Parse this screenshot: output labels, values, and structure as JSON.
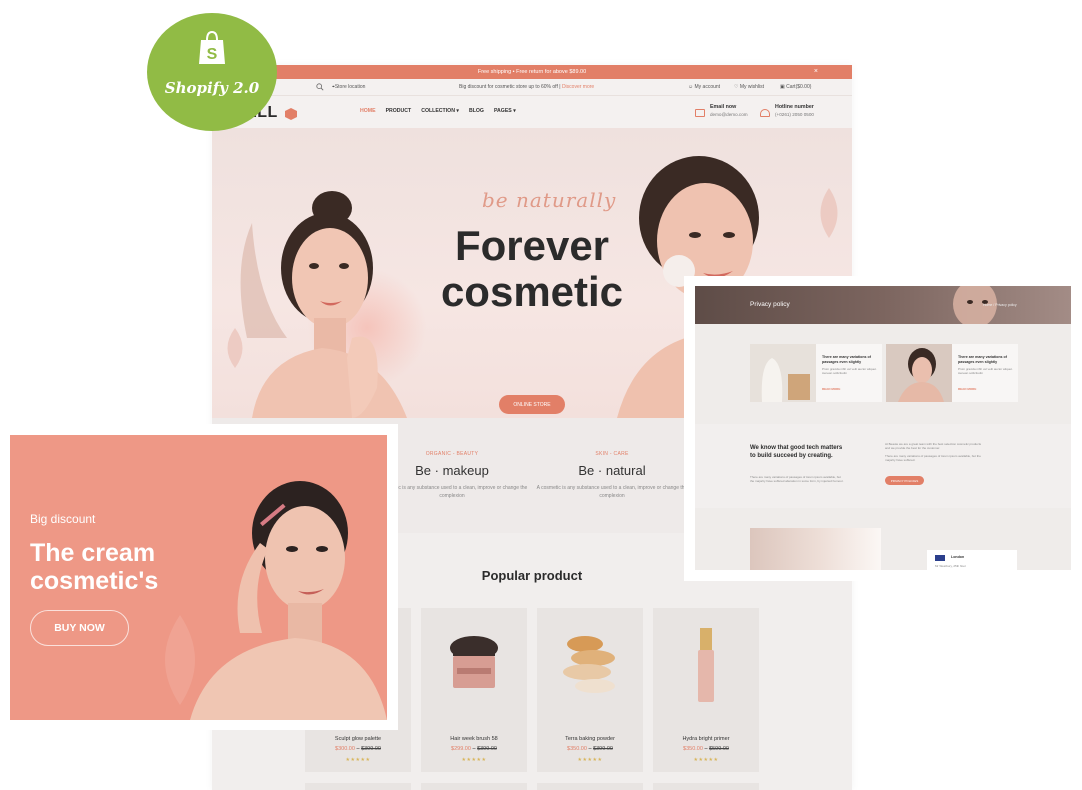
{
  "badge": {
    "label": "Shopify 2.0"
  },
  "site": {
    "announcement": "Free shipping • Free return for above $89.00",
    "announcement_close": "×",
    "topbar": {
      "store_location": "Store location",
      "promo": "Big discount for cosmetic store up to 60% off |",
      "promo_link": "Discover more",
      "my_account": "My account",
      "my_wishlist": "My wishlist",
      "cart": "Cart($0.00)"
    },
    "logo": "BELL",
    "nav": [
      "HOME",
      "PRODUCT",
      "COLLECTION ▾",
      "BLOG",
      "PAGES ▾"
    ],
    "email": {
      "label": "Email now",
      "value": "demo@demo.com"
    },
    "hotline": {
      "label": "Hotline number",
      "value": "(+0261) 2050 0500"
    },
    "hero": {
      "script": "be naturally",
      "title_line1": "Forever",
      "title_line2": "cosmetic",
      "button": "ONLINE STORE"
    },
    "features": [
      {
        "eyebrow": "ORGANIC - BEAUTY",
        "title": "Be · makeup",
        "desc": "A cosmetic is any substance used to a clean, improve or change the complexion"
      },
      {
        "eyebrow": "SKIN - CARE",
        "title": "Be · natural",
        "desc": "A cosmetic is any substance used to a clean, improve or change the complexion"
      }
    ],
    "popular_title": "Popular product",
    "products": [
      {
        "name": "Sculpt glow palette",
        "price": "$300.00",
        "old_price": "$399.00",
        "stars": "★★★★★"
      },
      {
        "name": "Hair week brush 58",
        "price": "$299.00",
        "old_price": "$399.00",
        "stars": "★★★★★"
      },
      {
        "name": "Terra baking powder",
        "price": "$350.00",
        "old_price": "$399.00",
        "stars": "★★★★★"
      },
      {
        "name": "Hydra bright primer",
        "price": "$350.00",
        "old_price": "$599.00",
        "stars": "★★★★★"
      }
    ],
    "price_separator": "–"
  },
  "promo_card": {
    "eyebrow": "Big discount",
    "title_line1": "The cream",
    "title_line2": "cosmetic's",
    "button": "BUY NOW"
  },
  "privacy": {
    "title": "Privacy policy",
    "breadcrumb": "Home / Privacy policy",
    "blogs": [
      {
        "title": "There are many variations of passages even slightly",
        "desc": "Proin gravida nibh vel velit auctor aliquet. Aenean sollicitudin",
        "more": "READ MORE"
      },
      {
        "title": "There are many variations of passages even slightly",
        "desc": "Proin gravida nibh vel velit auctor aliquet. Aenean sollicitudin",
        "more": "READ MORE"
      }
    ],
    "heading": "We know that good tech matters to build succeed by creating.",
    "small_text": "There are many variations of passages of lorem ipsum available, but the majority have suffered alteration in some form, by injected humour.",
    "body_1": "At Beaute we are a great team with the best selection cosmetic products and we provide the best for the customer.",
    "body_2": "There are many variations of passages of lorem ipsum available, but the majority have suffered.",
    "button": "PRIVACY POLICIES",
    "location": {
      "name": "London",
      "sub": "Mr Westbury, 25th floor"
    }
  }
}
